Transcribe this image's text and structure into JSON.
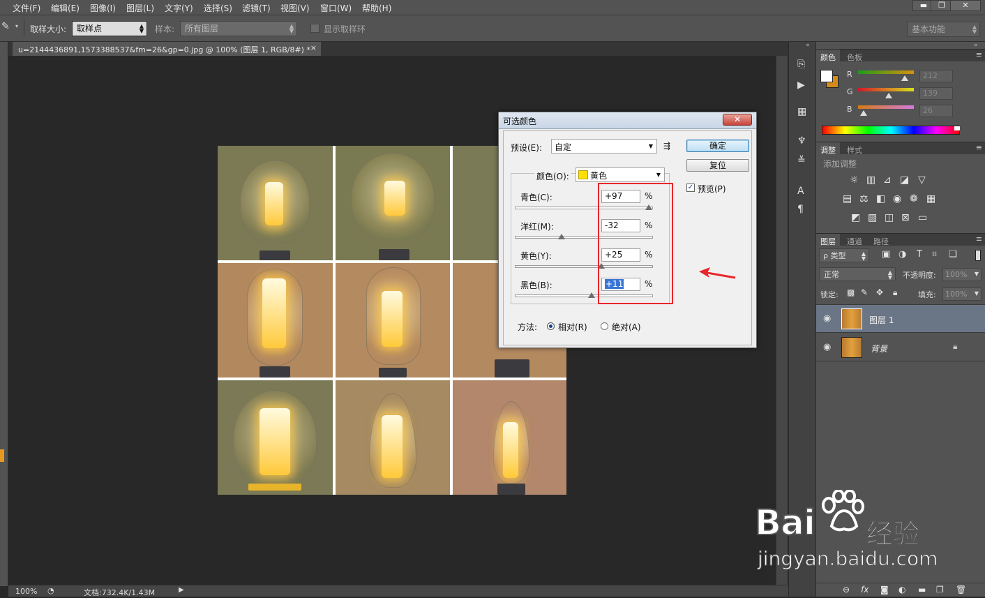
{
  "menubar": {
    "items": [
      "文件(F)",
      "编辑(E)",
      "图像(I)",
      "图层(L)",
      "文字(Y)",
      "选择(S)",
      "滤镜(T)",
      "视图(V)",
      "窗口(W)",
      "帮助(H)"
    ],
    "window_buttons": [
      "▬",
      "❐",
      "✕"
    ]
  },
  "optionbar": {
    "sample_size_label": "取样大小:",
    "sample_size_value": "取样点",
    "sample_label": "样本:",
    "sample_value": "所有图层",
    "show_ring_label": "显示取样环",
    "workspace": "基本功能"
  },
  "document": {
    "tab_title": "u=2144436891,1573388537&fm=26&gp=0.jpg @ 100% (图层 1, RGB/8#) *",
    "close": "×"
  },
  "statusbar": {
    "zoom": "100%",
    "doc_info": "文档:732.4K/1.43M"
  },
  "color_panel": {
    "tabs": [
      "颜色",
      "色板"
    ],
    "channels": [
      {
        "label": "R",
        "value": "212"
      },
      {
        "label": "G",
        "value": "139"
      },
      {
        "label": "B",
        "value": "26"
      }
    ],
    "foreground": "#ffffff",
    "background": "#d48b1a"
  },
  "adjust_panel": {
    "tabs": [
      "调整",
      "样式"
    ],
    "add_label": "添加调整"
  },
  "layers_panel": {
    "tabs": [
      "图层",
      "通道",
      "路径"
    ],
    "kind_label": "ρ 类型",
    "blend_mode": "正常",
    "opacity_label": "不透明度:",
    "opacity_value": "100%",
    "lock_label": "锁定:",
    "fill_label": "填充:",
    "fill_value": "100%",
    "layers": [
      {
        "name": "图层 1",
        "selected": true
      },
      {
        "name": "背景",
        "selected": false
      }
    ]
  },
  "dialog": {
    "title": "可选颜色",
    "close": "✕",
    "preset_label": "预设(E):",
    "preset_value": "自定",
    "ok": "确定",
    "reset": "复位",
    "preview_label": "预览(P)",
    "colors_label": "颜色(O):",
    "colors_value": "黄色",
    "colors_swatch": "#ffe100",
    "sliders": [
      {
        "label": "青色(C):",
        "value": "+97",
        "pos": 0.97,
        "unit": "%"
      },
      {
        "label": "洋红(M):",
        "value": "-32",
        "pos": 0.34,
        "unit": "%"
      },
      {
        "label": "黄色(Y):",
        "value": "+25",
        "pos": 0.625,
        "unit": "%"
      },
      {
        "label": "黑色(B):",
        "value": "+11",
        "pos": 0.555,
        "unit": "%"
      }
    ],
    "method_label": "方法:",
    "method_relative": "相对(R)",
    "method_absolute": "绝对(A)"
  },
  "watermark": {
    "brand": "Bai",
    "brand_cn": "经验",
    "url": "jingyan.baidu.com"
  }
}
